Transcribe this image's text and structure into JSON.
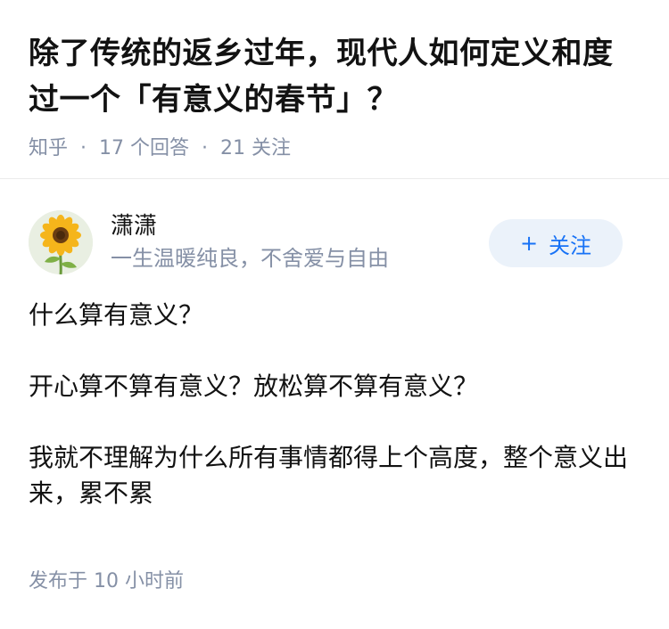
{
  "question": {
    "title": "除了传统的返乡过年，现代人如何定义和度过一个「有意义的春节」？",
    "source": "知乎",
    "separator": "·",
    "answers_count": "17 个回答",
    "followers_count": "21 关注"
  },
  "answer": {
    "author": {
      "name": "潇潇",
      "bio": "一生温暖纯良，不舍爱与自由",
      "avatar_icon": "sunflower-icon"
    },
    "follow_button": {
      "icon": "+",
      "label": "关注"
    },
    "paragraphs": [
      "什么算有意义？",
      "开心算不算有意义？放松算不算有意义？",
      "我就不理解为什么所有事情都得上个高度，整个意义出来，累不累"
    ],
    "published_label": "发布于 10 小时前"
  },
  "colors": {
    "meta_gray": "#8590a6",
    "accent_blue": "#1772f6",
    "follow_bg": "#ebf2fa"
  }
}
